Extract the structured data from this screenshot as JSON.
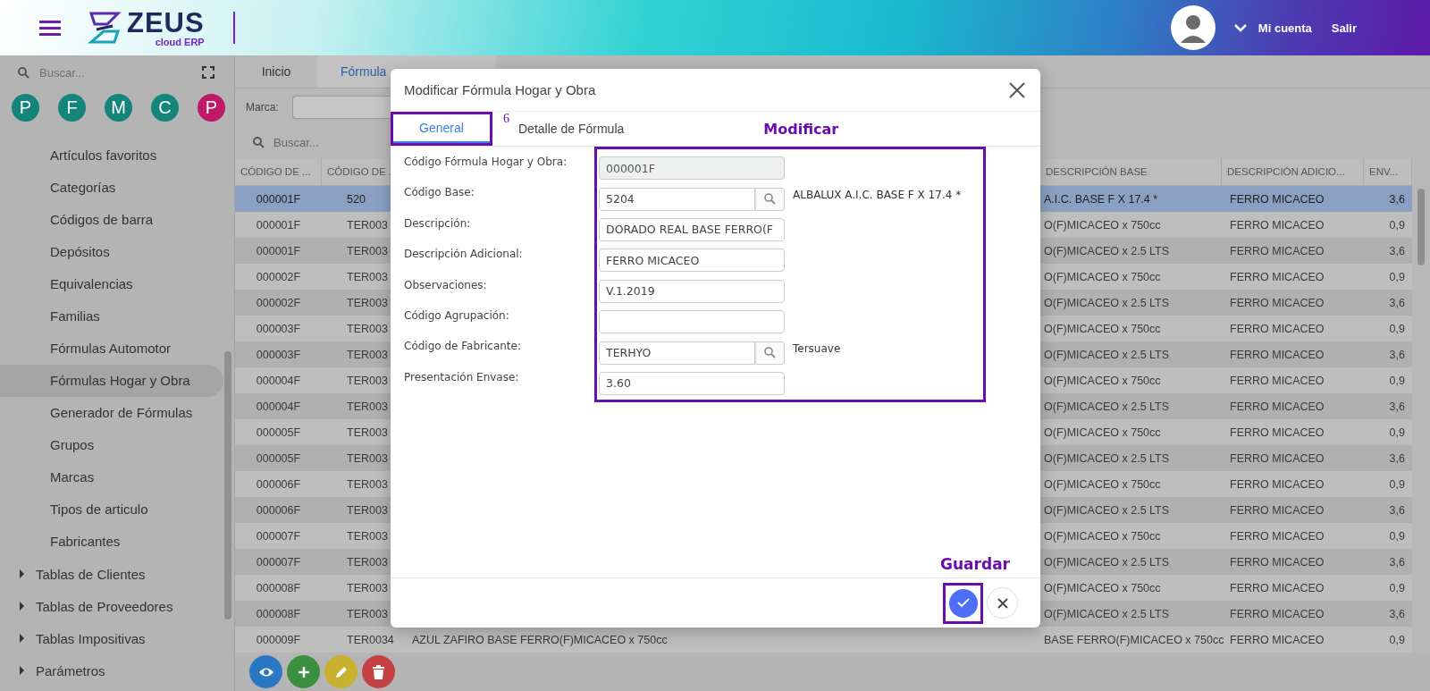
{
  "header": {
    "logo_word": "ZEUS",
    "logo_sub": "cloud ERP",
    "account": "Mi cuenta",
    "logout": "Salir"
  },
  "sidebar": {
    "search_placeholder": "Buscar...",
    "shortcuts": [
      {
        "letter": "P",
        "color": "#14857a"
      },
      {
        "letter": "F",
        "color": "#14857a"
      },
      {
        "letter": "M",
        "color": "#14857a"
      },
      {
        "letter": "C",
        "color": "#14857a"
      },
      {
        "letter": "P",
        "color": "#c0196a"
      }
    ],
    "items": [
      {
        "label": "Artículos favoritos",
        "selected": false
      },
      {
        "label": "Categorías",
        "selected": false
      },
      {
        "label": "Códigos de barra",
        "selected": false
      },
      {
        "label": "Depósitos",
        "selected": false
      },
      {
        "label": "Equivalencias",
        "selected": false
      },
      {
        "label": "Familias",
        "selected": false
      },
      {
        "label": "Fórmulas Automotor",
        "selected": false
      },
      {
        "label": "Fórmulas Hogar y Obra",
        "selected": true
      },
      {
        "label": "Generador de Fórmulas",
        "selected": false
      },
      {
        "label": "Grupos",
        "selected": false
      },
      {
        "label": "Marcas",
        "selected": false
      },
      {
        "label": "Tipos de articulo",
        "selected": false
      },
      {
        "label": "Fabricantes",
        "selected": false
      }
    ],
    "sections": [
      {
        "label": "Tablas de Clientes",
        "expanded": false
      },
      {
        "label": "Tablas de Proveedores",
        "expanded": false
      },
      {
        "label": "Tablas Impositivas",
        "expanded": false
      },
      {
        "label": "Parámetros",
        "expanded": false
      }
    ]
  },
  "tabs": [
    {
      "label": "Inicio",
      "selected": false
    },
    {
      "label": "Fórmula",
      "selected": true
    }
  ],
  "filter": {
    "label": "Marca:"
  },
  "search": {
    "placeholder": "Buscar..."
  },
  "table": {
    "columns": [
      "CÓDIGO DE ...",
      "CÓDIGO DE .",
      "DESCRIPCIÓN BASE",
      "DESCRIPCIÓN ADICIO...",
      "ENV..."
    ],
    "rows": [
      {
        "code": "000001F",
        "code_2": "520",
        "description_base": "A.I.C. BASE F X 17.4 *",
        "description_additional": "FERRO MICACEO",
        "envase": "3,6",
        "selected": true
      },
      {
        "code": "000001F",
        "code_2": "TER003",
        "description_base": "O(F)MICACEO x 750cc",
        "description_additional": "FERRO MICACEO",
        "envase": "0,9",
        "selected": false
      },
      {
        "code": "000001F",
        "code_2": "TER003",
        "description_base": "O(F)MICACEO x 2.5 LTS",
        "description_additional": "FERRO MICACEO",
        "envase": "3,6",
        "selected": false
      },
      {
        "code": "000002F",
        "code_2": "TER003",
        "description_base": "O(F)MICACEO x 750cc",
        "description_additional": "FERRO MICACEO",
        "envase": "0,9",
        "selected": false
      },
      {
        "code": "000002F",
        "code_2": "TER003",
        "description_base": "O(F)MICACEO x 2.5 LTS",
        "description_additional": "FERRO MICACEO",
        "envase": "3,6",
        "selected": false
      },
      {
        "code": "000003F",
        "code_2": "TER003",
        "description_base": "O(F)MICACEO x 750cc",
        "description_additional": "FERRO MICACEO",
        "envase": "0,9",
        "selected": false
      },
      {
        "code": "000003F",
        "code_2": "TER003",
        "description_base": "O(F)MICACEO x 2.5 LTS",
        "description_additional": "FERRO MICACEO",
        "envase": "3,6",
        "selected": false
      },
      {
        "code": "000004F",
        "code_2": "TER003",
        "description_base": "O(F)MICACEO x 750cc",
        "description_additional": "FERRO MICACEO",
        "envase": "0,9",
        "selected": false
      },
      {
        "code": "000004F",
        "code_2": "TER003",
        "description_base": "O(F)MICACEO x 2.5 LTS",
        "description_additional": "FERRO MICACEO",
        "envase": "3,6",
        "selected": false
      },
      {
        "code": "000005F",
        "code_2": "TER003",
        "description_base": "O(F)MICACEO x 750cc",
        "description_additional": "FERRO MICACEO",
        "envase": "0,9",
        "selected": false
      },
      {
        "code": "000005F",
        "code_2": "TER003",
        "description_base": "O(F)MICACEO x 2.5 LTS",
        "description_additional": "FERRO MICACEO",
        "envase": "3,6",
        "selected": false
      },
      {
        "code": "000006F",
        "code_2": "TER003",
        "description_base": "O(F)MICACEO x 750cc",
        "description_additional": "FERRO MICACEO",
        "envase": "0,9",
        "selected": false
      },
      {
        "code": "000006F",
        "code_2": "TER003",
        "description_base": "O(F)MICACEO x 2.5 LTS",
        "description_additional": "FERRO MICACEO",
        "envase": "3,6",
        "selected": false
      },
      {
        "code": "000007F",
        "code_2": "TER003",
        "description_base": "O(F)MICACEO x 750cc",
        "description_additional": "FERRO MICACEO",
        "envase": "0,9",
        "selected": false
      },
      {
        "code": "000007F",
        "code_2": "TER003",
        "description_base": "O(F)MICACEO x 2.5 LTS",
        "description_additional": "FERRO MICACEO",
        "envase": "3,6",
        "selected": false
      },
      {
        "code": "000008F",
        "code_2": "TER003",
        "description_base": "O(F)MICACEO x 750cc",
        "description_additional": "FERRO MICACEO",
        "envase": "0,9",
        "selected": false
      },
      {
        "code": "000008F",
        "code_2": "TER003",
        "description_base": "O(F)MICACEO x 2.5 LTS",
        "description_additional": "FERRO MICACEO",
        "envase": "3,6",
        "selected": false
      },
      {
        "code": "000009F",
        "code_2": "TER0034",
        "description": "AZUL ZAFIRO BASE FERRO(F)MICACEO x 750cc",
        "description_base": "BASE FERRO(F)MICACEO x 750cc",
        "description_additional": "FERRO MICACEO",
        "envase": "0,9",
        "selected": false
      }
    ]
  },
  "actions": [
    {
      "kind": "view"
    },
    {
      "kind": "add"
    },
    {
      "kind": "edit"
    },
    {
      "kind": "delete"
    }
  ],
  "dialog": {
    "title": "Modificar Fórmula Hogar y Obra",
    "tabs": [
      {
        "label": "General",
        "selected": true
      },
      {
        "label": "Detalle de Fórmula",
        "selected": false
      }
    ],
    "fields": [
      {
        "label": "Código Fórmula Hogar y Obra:",
        "value": "000001F",
        "readonly": true,
        "kind": "text"
      },
      {
        "label": "Código Base:",
        "value": "5204",
        "readonly": false,
        "kind": "lookup",
        "side_text": "ALBALUX A.I.C. BASE F X 17.4 *"
      },
      {
        "label": "Descripción:",
        "value": "DORADO REAL BASE FERRO(F",
        "readonly": false,
        "kind": "text"
      },
      {
        "label": "Descripción Adicional:",
        "value": "FERRO MICACEO",
        "readonly": false,
        "kind": "text"
      },
      {
        "label": "Observaciones:",
        "value": "V.1.2019",
        "readonly": false,
        "kind": "text"
      },
      {
        "label": "Código Agrupación:",
        "readonly": false,
        "kind": "text"
      },
      {
        "label": "Código de Fabricante:",
        "value": "TERHYO",
        "readonly": false,
        "kind": "lookup",
        "side_text": "Tersuave"
      },
      {
        "label": "Presentación Envase:",
        "value": "3.60",
        "readonly": false,
        "kind": "text"
      }
    ],
    "buttons": [
      {
        "kind": "confirm"
      },
      {
        "kind": "cancel"
      }
    ]
  },
  "annotations": {
    "tab_number": "6",
    "fields_note": "Modificar",
    "save_note": "Guardar"
  }
}
